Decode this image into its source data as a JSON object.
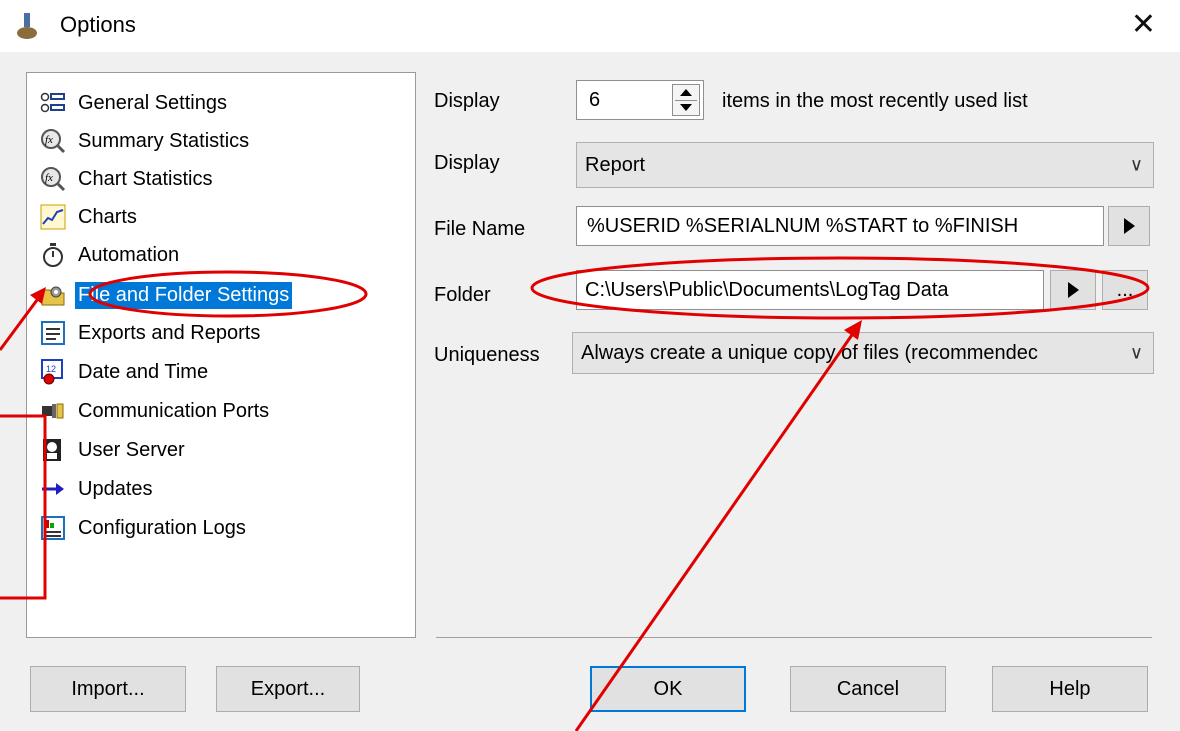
{
  "window": {
    "title": "Options",
    "close_glyph": "✕"
  },
  "nav": {
    "items": [
      {
        "label": "General Settings",
        "icon": "settings-list-icon"
      },
      {
        "label": "Summary Statistics",
        "icon": "function-magnifier-icon"
      },
      {
        "label": "Chart Statistics",
        "icon": "function-magnifier-icon"
      },
      {
        "label": "Charts",
        "icon": "chart-icon"
      },
      {
        "label": "Automation",
        "icon": "stopwatch-icon"
      },
      {
        "label": "File and Folder Settings",
        "icon": "folder-gear-icon",
        "selected": true
      },
      {
        "label": "Exports and Reports",
        "icon": "document-icon"
      },
      {
        "label": "Date and Time",
        "icon": "calendar-clock-icon"
      },
      {
        "label": "Communication Ports",
        "icon": "port-icon"
      },
      {
        "label": "User Server",
        "icon": "user-server-icon"
      },
      {
        "label": "Updates",
        "icon": "arrow-right-icon"
      },
      {
        "label": "Configuration Logs",
        "icon": "log-icon"
      }
    ]
  },
  "form": {
    "display_mru": {
      "label": "Display",
      "value": "6",
      "suffix": "items in the most recently used list"
    },
    "display_type": {
      "label": "Display",
      "value": "Report"
    },
    "file_name": {
      "label": "File Name",
      "value": "%USERID %SERIALNUM %START to %FINISH"
    },
    "folder": {
      "label": "Folder",
      "value": "C:\\Users\\Public\\Documents\\LogTag Data",
      "browse_label": "..."
    },
    "uniqueness": {
      "label": "Uniqueness",
      "value": "Always create a unique copy of files (recommendec"
    }
  },
  "buttons": {
    "import": "Import...",
    "export": "Export...",
    "ok": "OK",
    "cancel": "Cancel",
    "help": "Help"
  },
  "colors": {
    "selection": "#0078d7",
    "annotation": "#e00000",
    "default_button_border": "#0078d7"
  }
}
